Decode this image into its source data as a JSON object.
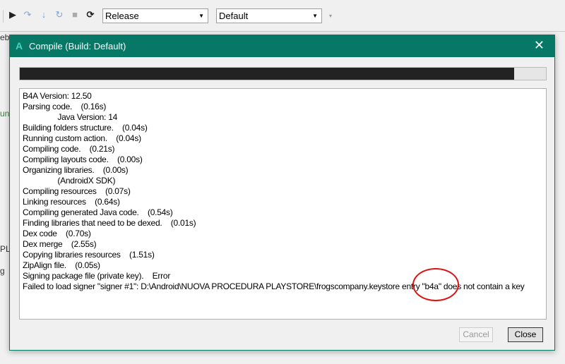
{
  "toolbar": {
    "icons": [
      "run-icon",
      "step-over-icon",
      "step-into-icon",
      "step-out-icon",
      "stop-icon",
      "restart-icon"
    ],
    "build_config": "Release",
    "build_target": "Default"
  },
  "background": {
    "fragments": [
      "eb",
      "un",
      "PL",
      "g"
    ]
  },
  "dialog": {
    "title": "Compile (Build: Default)",
    "accent": "#077766",
    "progress_percent": 94,
    "log": [
      "B4A Version: 12.50",
      "Parsing code.    (0.16s)",
      "                Java Version: 14",
      "Building folders structure.    (0.04s)",
      "Running custom action.    (0.04s)",
      "Compiling code.    (0.21s)",
      "Compiling layouts code.    (0.00s)",
      "Organizing libraries.    (0.00s)",
      "                (AndroidX SDK)",
      "Compiling resources    (0.07s)",
      "Linking resources    (0.64s)",
      "Compiling generated Java code.    (0.54s)",
      "Finding libraries that need to be dexed.    (0.01s)",
      "Dex code    (0.70s)",
      "Dex merge    (2.55s)",
      "Copying libraries resources    (1.51s)",
      "ZipAlign file.    (0.05s)",
      "Signing package file (private key).    Error",
      "Failed to load signer \"signer #1\": D:\\Android\\NUOVA PROCEDURA PLAYSTORE\\frogscompany.keystore entry \"b4a\" does not contain a key"
    ],
    "cancel_label": "Cancel",
    "close_label": "Close"
  }
}
